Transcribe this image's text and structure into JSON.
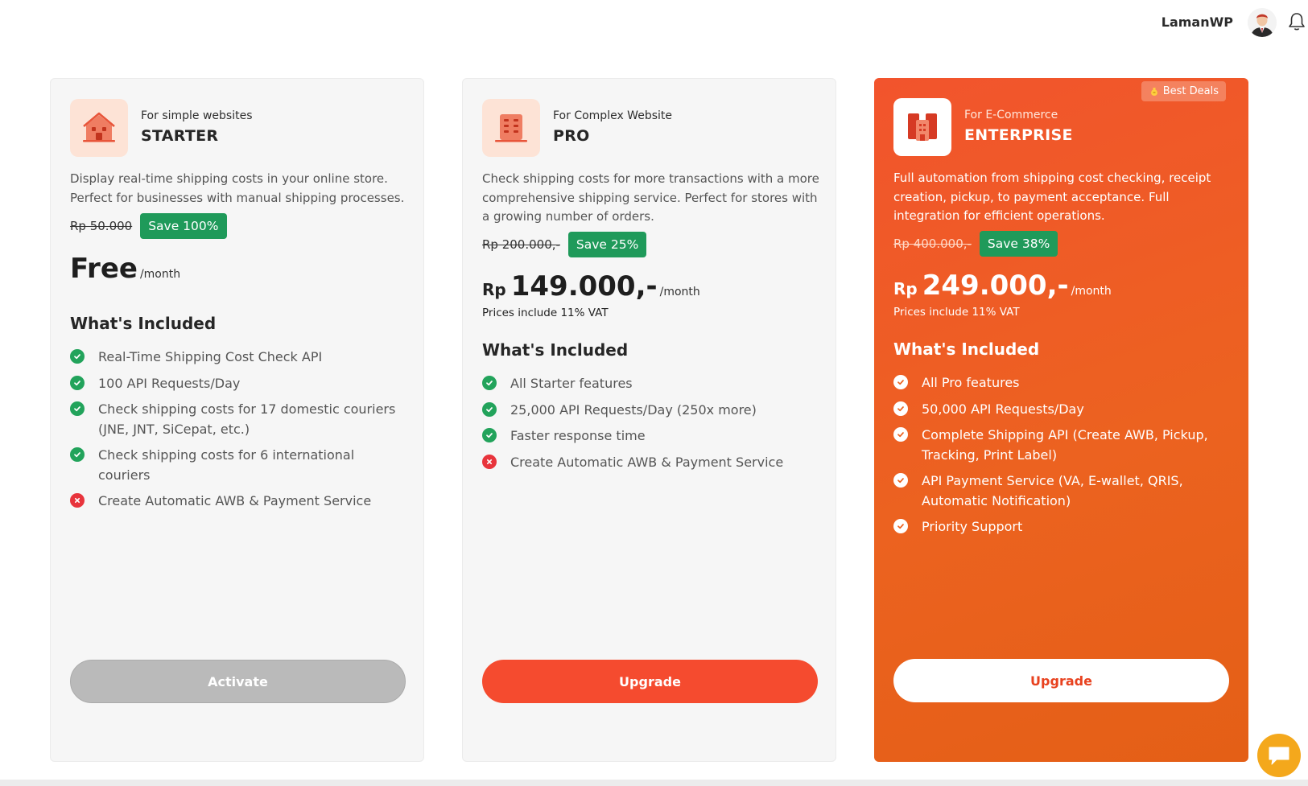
{
  "header": {
    "username": "LamanWP"
  },
  "plans": [
    {
      "subtitle": "For simple websites",
      "name": "STARTER",
      "description": "Display real-time shipping costs in your online store. Perfect for businesses with manual shipping processes.",
      "old_price": "Rp 50.000",
      "save": "Save 100%",
      "currency": "",
      "price": "Free",
      "per": "/month",
      "vat": "",
      "included_title": "What's Included",
      "features": [
        {
          "text": "Real-Time Shipping Cost Check API",
          "included": true
        },
        {
          "text": "100 API Requests/Day",
          "included": true
        },
        {
          "text": "Check shipping costs for 17 domestic couriers (JNE, JNT, SiCepat, etc.)",
          "included": true
        },
        {
          "text": "Check shipping costs for 6 international couriers",
          "included": true
        },
        {
          "text": "Create Automatic AWB & Payment Service",
          "included": false
        }
      ],
      "button": "Activate"
    },
    {
      "subtitle": "For Complex Website",
      "name": "PRO",
      "description": "Check shipping costs for more transactions with a more comprehensive shipping service. Perfect for stores with a growing number of orders.",
      "old_price": "Rp 200.000,-",
      "save": "Save 25%",
      "currency": "Rp",
      "price": "149.000,-",
      "per": "/month",
      "vat": "Prices include 11% VAT",
      "included_title": "What's Included",
      "features": [
        {
          "text": "All Starter features",
          "included": true
        },
        {
          "text": "25,000 API Requests/Day (250x more)",
          "included": true
        },
        {
          "text": "Faster response time",
          "included": true
        },
        {
          "text": "Create Automatic AWB & Payment Service",
          "included": false
        }
      ],
      "button": "Upgrade"
    },
    {
      "badge": "Best Deals",
      "subtitle": "For E-Commerce",
      "name": "ENTERPRISE",
      "description": "Full automation from shipping cost checking, receipt creation, pickup, to payment acceptance. Full integration for efficient operations.",
      "old_price": "Rp 400.000,-",
      "save": "Save 38%",
      "currency": "Rp",
      "price": "249.000,-",
      "per": "/month",
      "vat": "Prices include 11% VAT",
      "included_title": "What's Included",
      "features": [
        {
          "text": "All Pro features",
          "included": true
        },
        {
          "text": "50,000 API Requests/Day",
          "included": true
        },
        {
          "text": "Complete Shipping API (Create AWB, Pickup, Tracking, Print Label)",
          "included": true
        },
        {
          "text": "API Payment Service (VA, E-wallet, QRIS, Automatic Notification)",
          "included": true
        },
        {
          "text": "Priority Support",
          "included": true
        }
      ],
      "button": "Upgrade"
    }
  ],
  "colors": {
    "accent": "#f54b2f",
    "enterprise_bg": "#ec6220",
    "save_badge": "#1f9a5a",
    "included": "#22a35b",
    "excluded": "#e8343c",
    "chat": "#f4a81c"
  },
  "icons": {
    "starter": "house-icon",
    "pro": "building-icon",
    "enterprise": "office-buildings-icon",
    "notification": "bell-icon",
    "chat": "chat-bubble-icon"
  }
}
